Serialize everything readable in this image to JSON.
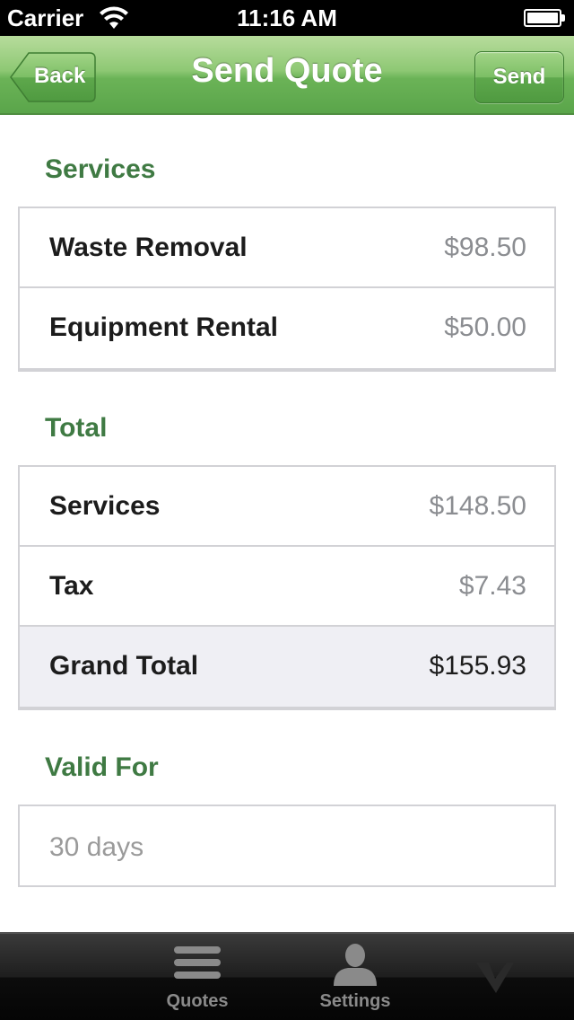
{
  "status_bar": {
    "carrier": "Carrier",
    "time": "11:16 AM"
  },
  "nav": {
    "back_label": "Back",
    "title": "Send Quote",
    "send_label": "Send"
  },
  "services": {
    "header": "Services",
    "items": [
      {
        "label": "Waste Removal",
        "value": "$98.50"
      },
      {
        "label": "Equipment Rental",
        "value": "$50.00"
      }
    ]
  },
  "total": {
    "header": "Total",
    "items": [
      {
        "label": "Services",
        "value": "$148.50"
      },
      {
        "label": "Tax",
        "value": "$7.43"
      },
      {
        "label": "Grand Total",
        "value": "$155.93"
      }
    ]
  },
  "valid_for": {
    "header": "Valid For",
    "placeholder": "30 days"
  },
  "tabs": [
    {
      "label": "Quotes",
      "icon": "list-icon"
    },
    {
      "label": "Settings",
      "icon": "person-icon"
    },
    {
      "label": "",
      "icon": "logo-icon"
    }
  ],
  "colors": {
    "accent_green": "#3f7a43",
    "nav_green": "#6bb357"
  }
}
